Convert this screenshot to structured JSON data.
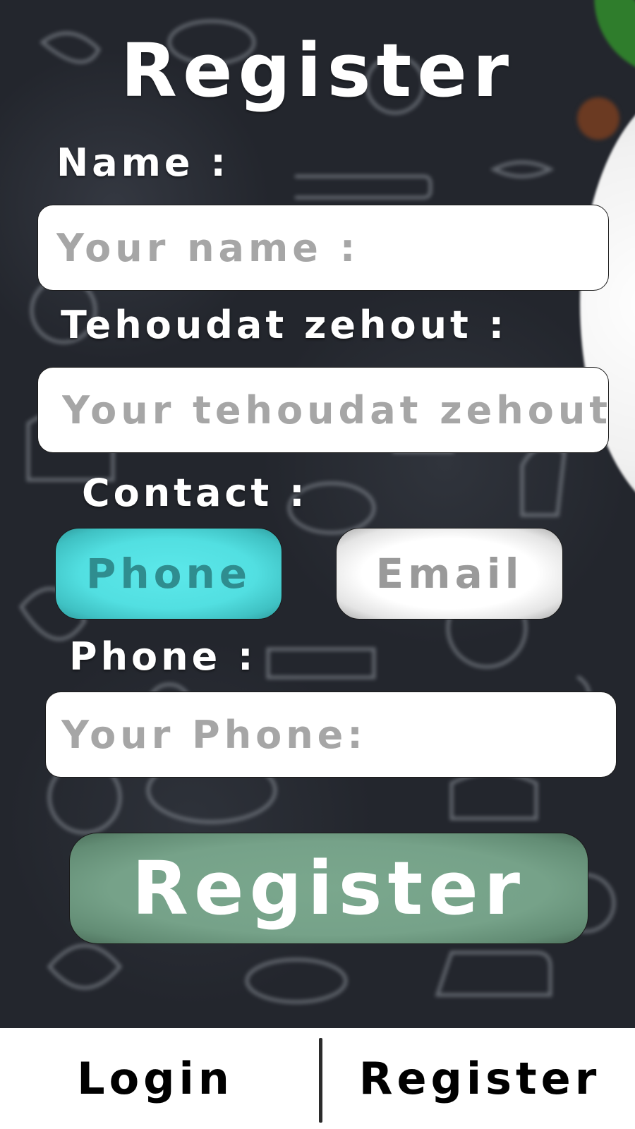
{
  "page": {
    "title": "Register"
  },
  "form": {
    "name": {
      "label": "Name :",
      "placeholder": "Your name :",
      "value": ""
    },
    "tehoudat": {
      "label": "Tehoudat zehout :",
      "placeholder": "Your tehoudat zehout :",
      "value": ""
    },
    "contact": {
      "label": "Contact :",
      "options": {
        "phone": "Phone",
        "email": "Email"
      },
      "selected": "Phone"
    },
    "phone": {
      "label": "Phone :",
      "placeholder": "Your Phone:",
      "value": ""
    },
    "submit_label": "Register"
  },
  "bottom_nav": {
    "login_label": "Login",
    "register_label": "Register"
  },
  "colors": {
    "background": "#23262d",
    "phone_toggle_active": "#52dfe1",
    "email_toggle_inactive": "#ffffff",
    "register_button": "#76a289",
    "nav_background": "#ffffff"
  }
}
